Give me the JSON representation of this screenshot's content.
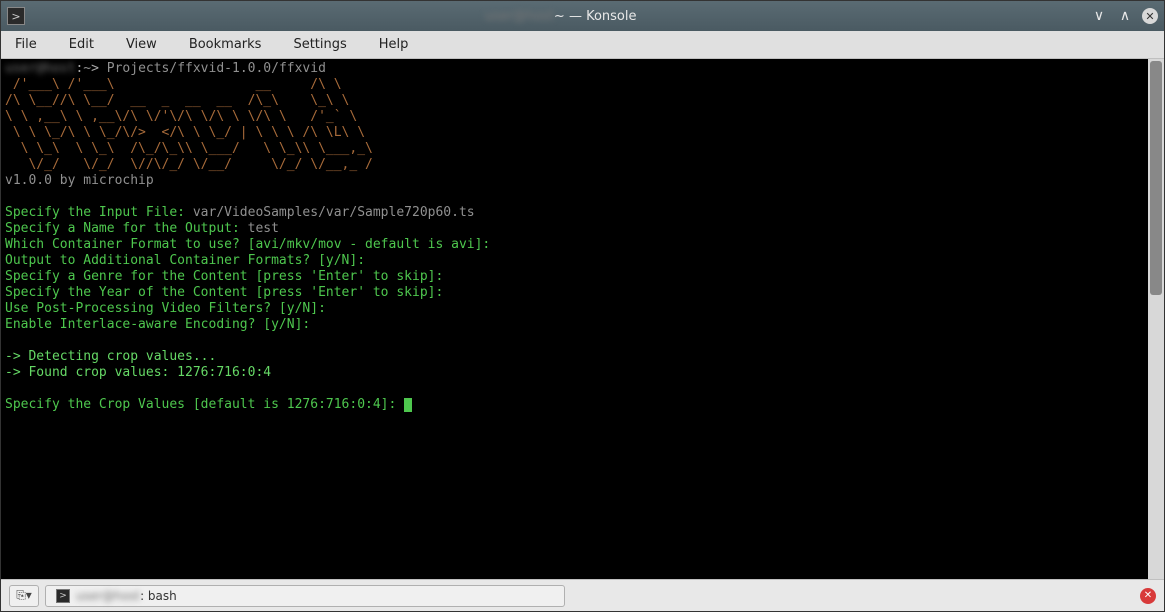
{
  "titlebar": {
    "title": "~ — Konsole",
    "title_prefix_blurred": "user@host",
    "icon_glyph": ">",
    "min_glyph": "∨",
    "max_glyph": "∧",
    "close_glyph": "✕"
  },
  "menubar": {
    "file": "File",
    "edit": "Edit",
    "view": "View",
    "bookmarks": "Bookmarks",
    "settings": "Settings",
    "help": "Help"
  },
  "terminal": {
    "prompt_user_blurred": "user@host",
    "prompt_sep": ":",
    "prompt_path": "~",
    "prompt_end": ">",
    "command": "Projects/ffxvid-1.0.0/ffxvid",
    "ascii1": " /'___\\ /'___\\                  __     /\\ \\",
    "ascii2": "/\\ \\__//\\ \\__/  __  _  __  __  /\\_\\    \\_\\ \\",
    "ascii3": "\\ \\ ,__\\ \\ ,__\\/\\ \\/'\\/\\ \\/\\ \\ \\/\\ \\   /'_` \\",
    "ascii4": " \\ \\ \\_/\\ \\ \\_/\\/>  </\\ \\ \\_/ | \\ \\ \\ /\\ \\L\\ \\",
    "ascii5": "  \\ \\_\\  \\ \\_\\  /\\_/\\_\\\\ \\___/   \\ \\_\\\\ \\___,_\\",
    "ascii6": "   \\/_/   \\/_/  \\//\\/_/ \\/__/     \\/_/ \\/__,_ /",
    "version": "v1.0.0 by microchip",
    "q_input_file": "Specify the Input File: ",
    "a_input_file": "var/VideoSamples/var/Sample720p60.ts",
    "q_output_name": "Specify a Name for the Output: ",
    "a_output_name": "test",
    "q_container": "Which Container Format to use? [avi/mkv/mov - default is avi]:",
    "q_additional": "Output to Additional Container Formats? [y/N]:",
    "q_genre": "Specify a Genre for the Content [press 'Enter' to skip]:",
    "q_year": "Specify the Year of the Content [press 'Enter' to skip]:",
    "q_postproc": "Use Post-Processing Video Filters? [y/N]:",
    "q_interlace": "Enable Interlace-aware Encoding? [y/N]:",
    "detecting": "-> Detecting crop values...",
    "found": "-> Found crop values: 1276:716:0:4",
    "q_crop": "Specify the Crop Values [default is 1276:716:0:4]: "
  },
  "bottombar": {
    "newtab_glyph": "⎘▾",
    "tab_icon_glyph": ">",
    "tab_label_prefix_blurred": "user@host",
    "tab_label_suffix": ": bash",
    "close_glyph": "✕"
  }
}
